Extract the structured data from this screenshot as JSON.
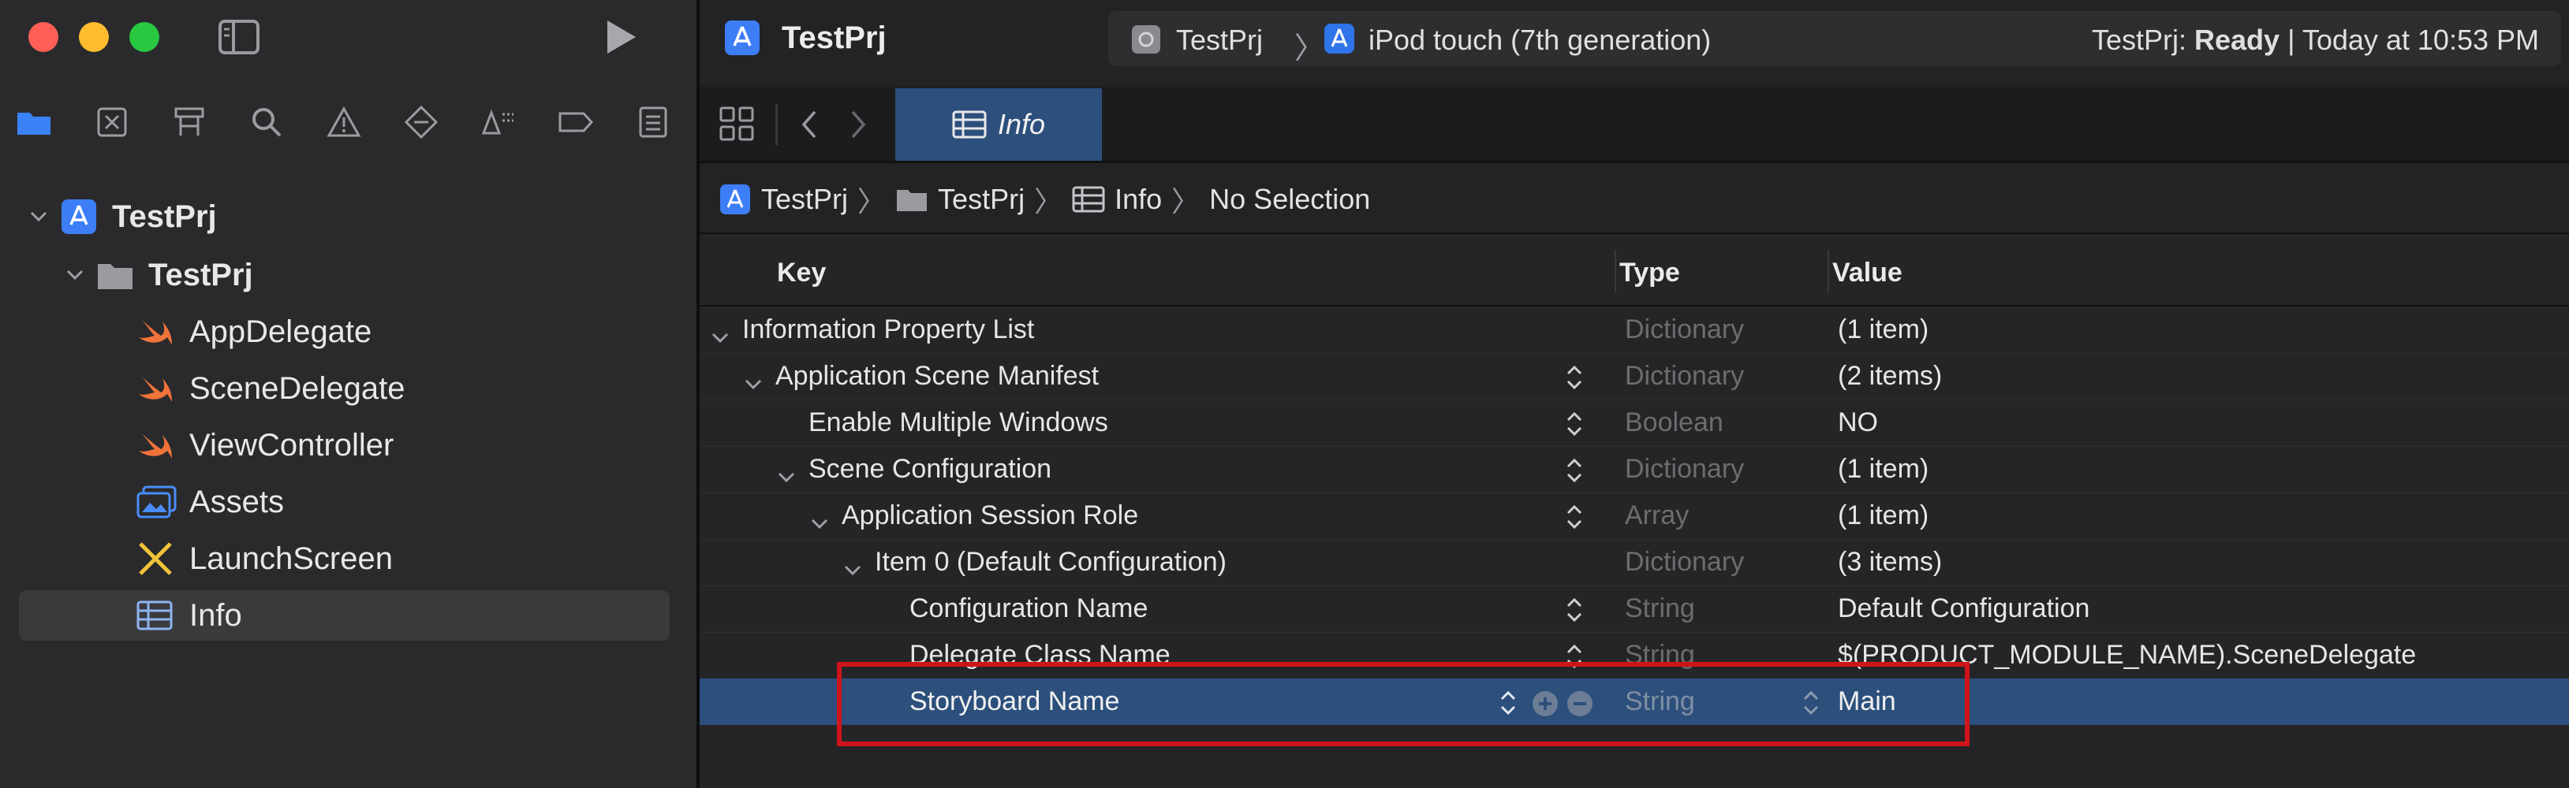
{
  "window": {
    "project_title": "TestPrj",
    "scheme_project": "TestPrj",
    "device": "iPod touch (7th generation)",
    "status_project": "TestPrj:",
    "status_state": "Ready",
    "status_separator": "|",
    "status_time": "Today at 10:53 PM"
  },
  "navigator": {
    "tree": [
      {
        "label": "TestPrj",
        "icon": "project-icon"
      },
      {
        "label": "TestPrj",
        "icon": "folder-icon"
      },
      {
        "label": "AppDelegate",
        "icon": "swift-file-icon"
      },
      {
        "label": "SceneDelegate",
        "icon": "swift-file-icon"
      },
      {
        "label": "ViewController",
        "icon": "swift-file-icon"
      },
      {
        "label": "Assets",
        "icon": "assets-icon"
      },
      {
        "label": "LaunchScreen",
        "icon": "storyboard-icon"
      },
      {
        "label": "Info",
        "icon": "plist-icon"
      }
    ]
  },
  "editor": {
    "tab_label": "Info",
    "breadcrumb": [
      "TestPrj",
      "TestPrj",
      "Info",
      "No Selection"
    ],
    "columns": {
      "key": "Key",
      "type": "Type",
      "value": "Value"
    },
    "rows": [
      {
        "key": "Information Property List",
        "type": "Dictionary",
        "value": "(1 item)"
      },
      {
        "key": "Application Scene Manifest",
        "type": "Dictionary",
        "value": "(2 items)"
      },
      {
        "key": "Enable Multiple Windows",
        "type": "Boolean",
        "value": "NO"
      },
      {
        "key": "Scene Configuration",
        "type": "Dictionary",
        "value": "(1 item)"
      },
      {
        "key": "Application Session Role",
        "type": "Array",
        "value": "(1 item)"
      },
      {
        "key": "Item 0 (Default Configuration)",
        "type": "Dictionary",
        "value": "(3 items)"
      },
      {
        "key": "Configuration Name",
        "type": "String",
        "value": "Default Configuration"
      },
      {
        "key": "Delegate Class Name",
        "type": "String",
        "value": "$(PRODUCT_MODULE_NAME).SceneDelegate"
      },
      {
        "key": "Storyboard Name",
        "type": "String",
        "value": "Main"
      }
    ]
  },
  "colors": {
    "accent": "#2f6ad9",
    "selection": "#2c4f7c",
    "highlight_box": "#d0141b"
  }
}
